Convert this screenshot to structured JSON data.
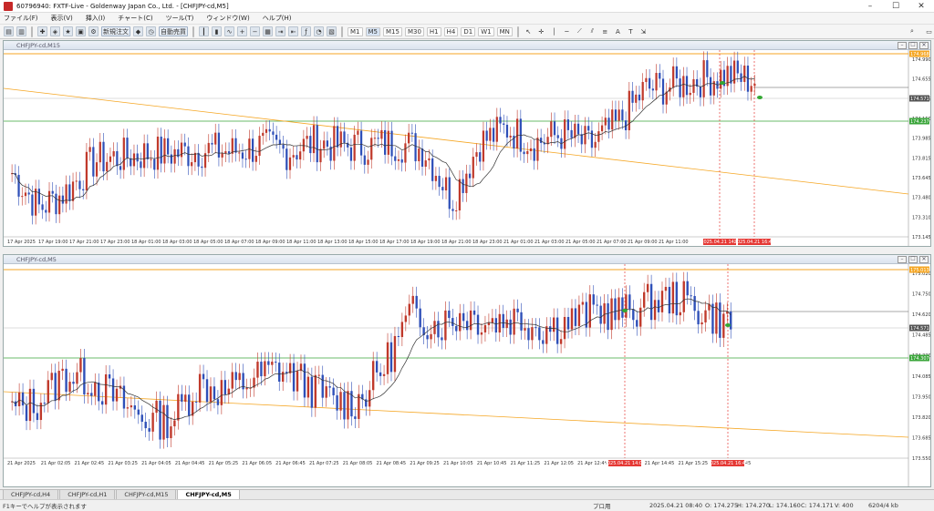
{
  "window": {
    "title": "60796940: FXTF-Live - Goldenway Japan Co., Ltd. - [CHFJPY-cd,M5]",
    "minimize": "–",
    "maximize": "☐",
    "close": "✕"
  },
  "menu": [
    "ファイル(F)",
    "表示(V)",
    "挿入(I)",
    "チャート(C)",
    "ツール(T)",
    "ウィンドウ(W)",
    "ヘルプ(H)"
  ],
  "toolbar": {
    "new_order": "新規注文",
    "auto_trading": "自動売買",
    "timeframes": [
      "M1",
      "M5",
      "M15",
      "M30",
      "H1",
      "H4",
      "D1",
      "W1",
      "MN"
    ],
    "active_timeframe": "M5"
  },
  "chart1": {
    "label": "CHFJPY-cd,M15",
    "title_text": "CHFJPY-cd,M15",
    "price_labels": [
      "174.990",
      "174.655",
      "174.485",
      "174.150",
      "173.985",
      "173.815",
      "173.645",
      "173.480",
      "173.310",
      "173.145"
    ],
    "marker_top": "174.968",
    "marker_ask": "174.571",
    "marker_green": "174.237",
    "time_labels": [
      "17 Apr 2025",
      "17 Apr 19:00",
      "17 Apr 21:00",
      "17 Apr 23:00",
      "18 Apr 01:00",
      "18 Apr 03:00",
      "18 Apr 05:00",
      "18 Apr 07:00",
      "18 Apr 09:00",
      "18 Apr 11:00",
      "18 Apr 13:00",
      "18 Apr 15:00",
      "18 Apr 17:00",
      "18 Apr 19:00",
      "18 Apr 21:00",
      "18 Apr 23:00",
      "21 Apr 01:00",
      "21 Apr 03:00",
      "21 Apr 05:00",
      "21 Apr 07:00",
      "21 Apr 09:00",
      "21 Apr 11:00"
    ],
    "vline_labels": [
      "2025.04.21 14:0",
      "2025.04.21 16:45"
    ]
  },
  "chart2": {
    "label": "CHFJPY-cd,M5",
    "price_labels": [
      "175.020",
      "174.750",
      "174.620",
      "174.485",
      "174.220",
      "174.085",
      "173.950",
      "173.820",
      "173.685",
      "173.550"
    ],
    "marker_top": "175.013",
    "marker_ask": "174.571",
    "marker_green": "174.307",
    "time_labels": [
      "21 Apr 2025",
      "21 Apr 02:05",
      "21 Apr 02:45",
      "21 Apr 03:25",
      "21 Apr 04:05",
      "21 Apr 04:45",
      "21 Apr 05:25",
      "21 Apr 06:05",
      "21 Apr 06:45",
      "21 Apr 07:25",
      "21 Apr 08:05",
      "21 Apr 08:45",
      "21 Apr 09:25",
      "21 Apr 10:05",
      "21 Apr 10:45",
      "21 Apr 11:25",
      "21 Apr 12:05",
      "21 Apr 12:45",
      "21 Apr 13:25",
      "21 Apr 14:45",
      "21 Apr 15:25",
      "21 Ap",
      "45"
    ],
    "vline_labels": [
      "2025.04.21 14:05",
      "2025.04.21 16:45"
    ]
  },
  "tabs": [
    {
      "label": "CHFJPY-cd,H4",
      "active": false
    },
    {
      "label": "CHFJPY-cd,H1",
      "active": false
    },
    {
      "label": "CHFJPY-cd,M15",
      "active": false
    },
    {
      "label": "CHFJPY-cd,M5",
      "active": true
    }
  ],
  "status": {
    "help": "F1キーでヘルプが表示されます",
    "profile": "プロ用",
    "datetime": "2025.04.21 08:40",
    "open": "O: 174.275",
    "high": "H: 174.270",
    "low": "L: 174.160",
    "close": "C: 174.171",
    "volume": "V: 400",
    "traffic": "6204/4 kb"
  },
  "colors": {
    "bull": "#c0392b",
    "bear": "#2e4fb8",
    "ma": "#333333",
    "trend": "#f5a623",
    "support": "#3aa53a",
    "top_line": "#f5a623",
    "vline": "#e53935"
  }
}
